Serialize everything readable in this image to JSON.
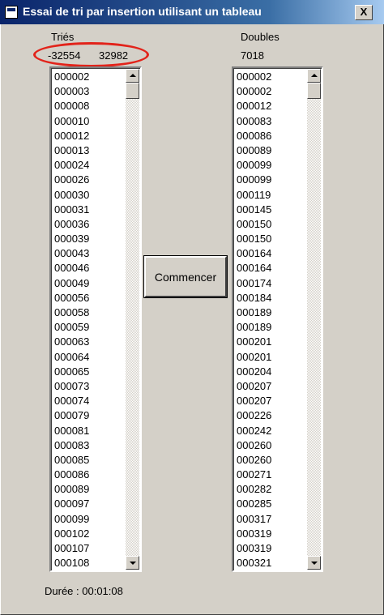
{
  "window": {
    "title": "Essai de tri par insertion utilisant un tableau",
    "close_glyph": "X"
  },
  "left": {
    "header": "Triés",
    "range_min": "-32554",
    "range_max": "32982",
    "items": [
      "000002",
      "000003",
      "000008",
      "000010",
      "000012",
      "000013",
      "000024",
      "000026",
      "000030",
      "000031",
      "000036",
      "000039",
      "000043",
      "000046",
      "000049",
      "000056",
      "000058",
      "000059",
      "000063",
      "000064",
      "000065",
      "000073",
      "000074",
      "000079",
      "000081",
      "000083",
      "000085",
      "000086",
      "000089",
      "000097",
      "000099",
      "000102",
      "000107",
      "000108"
    ]
  },
  "right": {
    "header": "Doubles",
    "count": "7018",
    "items": [
      "000002",
      "000002",
      "000012",
      "000083",
      "000086",
      "000089",
      "000099",
      "000099",
      "000119",
      "000145",
      "000150",
      "000150",
      "000164",
      "000164",
      "000174",
      "000184",
      "000189",
      "000189",
      "000201",
      "000201",
      "000204",
      "000207",
      "000207",
      "000226",
      "000242",
      "000260",
      "000260",
      "000271",
      "000282",
      "000285",
      "000317",
      "000319",
      "000319",
      "000321"
    ]
  },
  "start_button": "Commencer",
  "duration": "Durée : 00:01:08",
  "highlight_color": "#e2231a"
}
